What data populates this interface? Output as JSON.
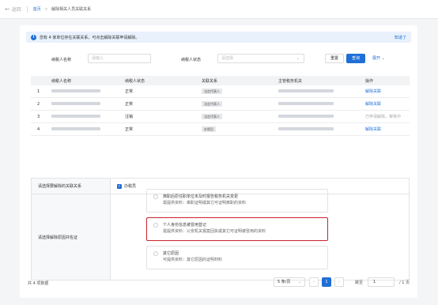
{
  "topbar": {
    "back": "返回",
    "crumb_home": "首页",
    "crumb_sep": ">",
    "crumb_current": "解除相关人员关联关系"
  },
  "notice": {
    "text": "您有 4 家单位存在关联关系，可点击解除关联申请解除。",
    "close": "知道了"
  },
  "filter": {
    "name_label": "纳税人名称",
    "name_placeholder": "请输入",
    "status_label": "纳税人状态",
    "status_placeholder": "请选择",
    "reset": "重置",
    "query": "查询",
    "expand": "展开"
  },
  "table": {
    "headers": [
      "",
      "纳税人名称",
      "纳税人状态",
      "关联关系",
      "主管税务机关",
      "操作"
    ],
    "rows": [
      {
        "no": "1",
        "status": "正常",
        "relation": "法定代表人",
        "action": "解除关联",
        "action_enabled": true
      },
      {
        "no": "2",
        "status": "正常",
        "relation": "法定代表人",
        "action": "解除关联",
        "action_enabled": true
      },
      {
        "no": "3",
        "status": "注销",
        "relation": "法定代表人",
        "action": "已申请解除，审核中",
        "action_enabled": false
      },
      {
        "no": "4",
        "status": "正常",
        "relation": "办税员",
        "action": "解除关联",
        "action_enabled": true
      }
    ]
  },
  "panel": {
    "relation_label": "请选择要解除的关联关系",
    "relation_value": "办税员",
    "reason_label": "请选择解除原因并佐证",
    "options": [
      {
        "title": "离职后原任职单位未及时报告税务机关变更",
        "sub": "需提供资料：离职证明或其它可证明离职的资料"
      },
      {
        "title": "个人身份信息被冒用登记",
        "sub": "需提供资料：公安机关报案回执或其它可证明被冒用的资料"
      },
      {
        "title": "其它原因",
        "sub": "可提供资料：其它原因的证明材料"
      }
    ]
  },
  "footer": {
    "total": "共 4 项数据",
    "page_size": "5 条/页",
    "current_page": "1",
    "jump_label": "跳至",
    "jump_value": "1",
    "pages": "/ 1 页"
  },
  "colors": {
    "accent": "#1f6fd6",
    "highlight": "#c8232c"
  }
}
